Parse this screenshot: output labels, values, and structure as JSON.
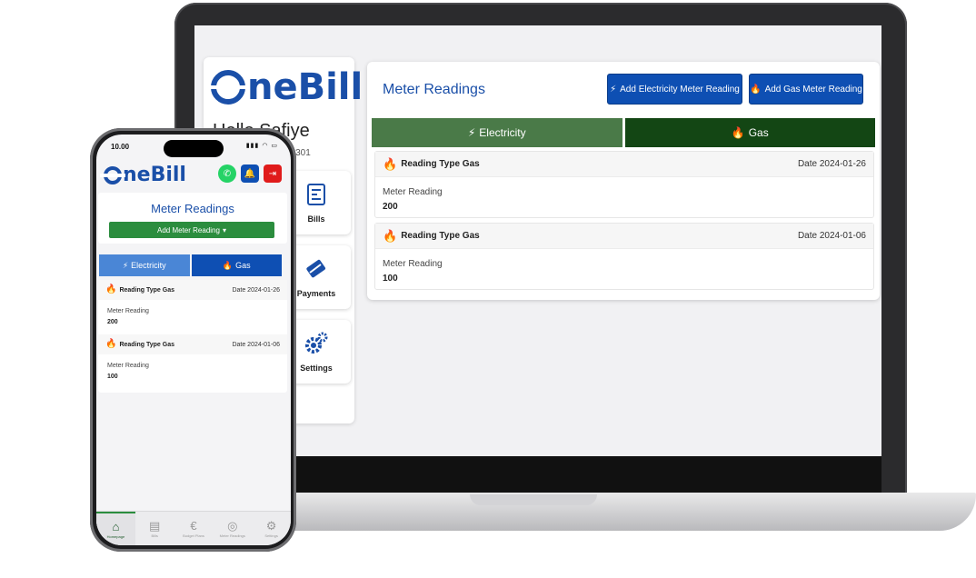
{
  "colors": {
    "brand_blue": "#1a4fa8",
    "button_blue": "#0e4fb3",
    "electricity_tab": "#4a7a48",
    "gas_tab": "#134614",
    "flame": "#d93838",
    "add_green": "#2b8d3e"
  },
  "brand": {
    "logo_text": "neBill"
  },
  "desktop": {
    "greeting": "Hello Safiye",
    "account": "33301",
    "tiles": [
      {
        "label": "Bills",
        "icon": "bill-icon"
      },
      {
        "label": "Payments",
        "icon": "card-icon"
      },
      {
        "label": "Settings",
        "icon": "gear-icon"
      }
    ],
    "title": "Meter Readings",
    "add_electricity_label": "Add Electricity Meter Reading",
    "add_gas_label": "Add Gas Meter Reading",
    "tabs": {
      "electricity": "Electricity",
      "gas": "Gas"
    },
    "readings": [
      {
        "type": "Reading Type Gas",
        "date": "Date 2024-01-26",
        "meter_label": "Meter Reading",
        "value": "200"
      },
      {
        "type": "Reading Type Gas",
        "date": "Date 2024-01-06",
        "meter_label": "Meter Reading",
        "value": "100"
      }
    ]
  },
  "mobile": {
    "time": "10.00",
    "title": "Meter Readings",
    "add_label": "Add Meter Reading",
    "tabs": {
      "electricity": "Electricity",
      "gas": "Gas"
    },
    "readings": [
      {
        "type": "Reading Type Gas",
        "date": "Date 2024-01-26",
        "meter_label": "Meter Reading",
        "value": "200"
      },
      {
        "type": "Reading Type Gas",
        "date": "Date 2024-01-06",
        "meter_label": "Meter Reading",
        "value": "100"
      }
    ],
    "nav": [
      {
        "label": "Homepage",
        "icon": "home-icon"
      },
      {
        "label": "Bills",
        "icon": "bill-icon"
      },
      {
        "label": "Budget Plans",
        "icon": "euro-icon"
      },
      {
        "label": "Meter Readings",
        "icon": "meter-icon"
      },
      {
        "label": "Settings",
        "icon": "gear-icon"
      }
    ]
  }
}
